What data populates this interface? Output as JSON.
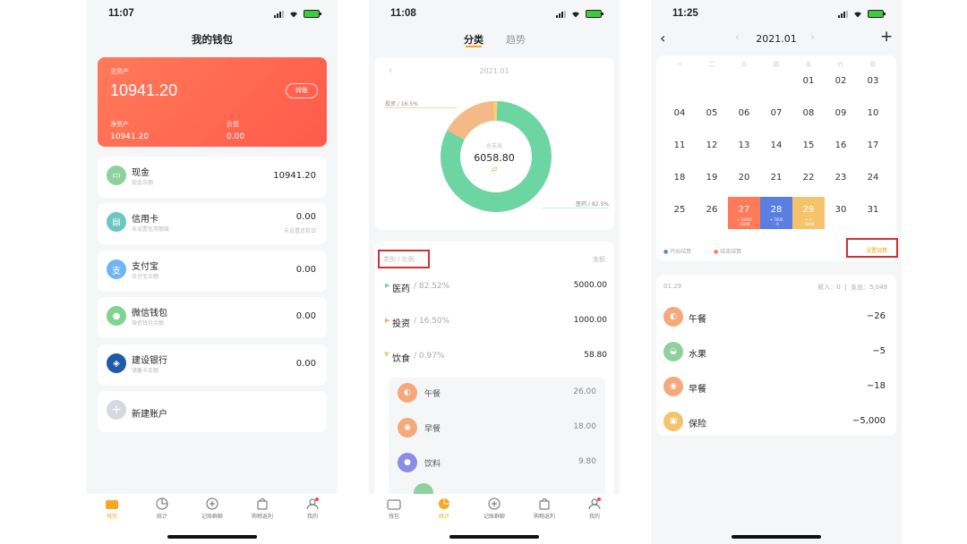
{
  "status": {
    "p1_time": "11:07",
    "p2_time": "11:08",
    "p3_time": "11:25"
  },
  "wallet": {
    "title": "我的钱包",
    "total_label": "总资产",
    "total": "10941.20",
    "transfer_label": "转账",
    "net_label": "净资产",
    "net": "10941.20",
    "debt_label": "负债",
    "debt": "0.00",
    "accounts": [
      {
        "name": "现金",
        "sub": "现金余额",
        "value": "10941.20",
        "sub2": "",
        "icon": "cash-icon",
        "color": "#8fd19e"
      },
      {
        "name": "信用卡",
        "sub": "未设置信用额度",
        "value": "0.00",
        "sub2": "未设置还款日",
        "icon": "credit-card-icon",
        "color": "#6cc7c0"
      },
      {
        "name": "支付宝",
        "sub": "支付宝余额",
        "value": "0.00",
        "sub2": "",
        "icon": "alipay-icon",
        "color": "#6fb6f0"
      },
      {
        "name": "微信钱包",
        "sub": "微信钱包余额",
        "value": "0.00",
        "sub2": "",
        "icon": "wechat-icon",
        "color": "#7fd48f"
      },
      {
        "name": "建设银行",
        "sub": "储蓄卡余额",
        "value": "0.00",
        "sub2": "",
        "icon": "ccb-bank-icon",
        "color": "#1f5aa8"
      }
    ],
    "new_account": "新建账户",
    "tabs": [
      "钱包",
      "统计",
      "记账群聊",
      "购物返利",
      "我的"
    ]
  },
  "stats": {
    "tab_category": "分类",
    "tab_trend": "趋势",
    "month": "2021.01",
    "donut_center_label": "总支出",
    "donut_center_value": "6058.80",
    "label_invest": "投资 / 16.5%",
    "label_medical": "医药 / 82.5%",
    "header_left": "类别 / 比例",
    "header_right": "金额",
    "categories": [
      {
        "name": "医药",
        "pct": "/ 82.52%",
        "value": "5000.00",
        "color": "#6dd5a2"
      },
      {
        "name": "投资",
        "pct": "/ 16.50%",
        "value": "1000.00",
        "color": "#f5a87a"
      },
      {
        "name": "饮食",
        "pct": "/ 0.97%",
        "value": "58.80",
        "color": "#f5c36b"
      }
    ],
    "sub_items": [
      {
        "name": "午餐",
        "value": "26.00",
        "color": "#f5a87a",
        "icon": "lunch-icon"
      },
      {
        "name": "早餐",
        "value": "18.00",
        "color": "#f5a87a",
        "icon": "breakfast-icon"
      },
      {
        "name": "饮料",
        "value": "9.80",
        "color": "#8a8de8",
        "icon": "drink-icon"
      }
    ]
  },
  "chart_data": {
    "type": "pie",
    "categories": [
      "医药",
      "投资",
      "饮食"
    ],
    "values": [
      82.52,
      16.5,
      0.97
    ],
    "colors": [
      "#6dd5a2",
      "#f5b987",
      "#f5d36b"
    ]
  },
  "calendar": {
    "month": "2021.01",
    "weekdays": [
      "一",
      "二",
      "三",
      "四",
      "五",
      "六",
      "日"
    ],
    "days": [
      "",
      "",
      "",
      "",
      "01",
      "02",
      "03",
      "04",
      "05",
      "06",
      "07",
      "08",
      "09",
      "10",
      "11",
      "12",
      "13",
      "14",
      "15",
      "16",
      "17",
      "18",
      "19",
      "20",
      "21",
      "22",
      "23",
      "24",
      "25",
      "26",
      "27",
      "28",
      "29",
      "30",
      "31"
    ],
    "day27_note": "+ 10000\n- 5000",
    "day28_note": "+ 7000\n- 0",
    "day29_note": "+ 0\n- 5049",
    "legend_start": "开始结算",
    "legend_end": "结束结算",
    "setting_link": "设置结算",
    "summary_date": "01.29",
    "summary_income": "收入：0",
    "summary_expense": "支出：5,049",
    "entries": [
      {
        "name": "午餐",
        "value": "−26",
        "color": "#f5a87a",
        "icon": "lunch-icon"
      },
      {
        "name": "水果",
        "value": "−5",
        "color": "#8fd19e",
        "icon": "fruit-icon"
      },
      {
        "name": "早餐",
        "value": "−18",
        "color": "#f5a87a",
        "icon": "breakfast-icon"
      },
      {
        "name": "保险",
        "value": "−5,000",
        "color": "#f5c36b",
        "icon": "insurance-icon"
      }
    ]
  }
}
